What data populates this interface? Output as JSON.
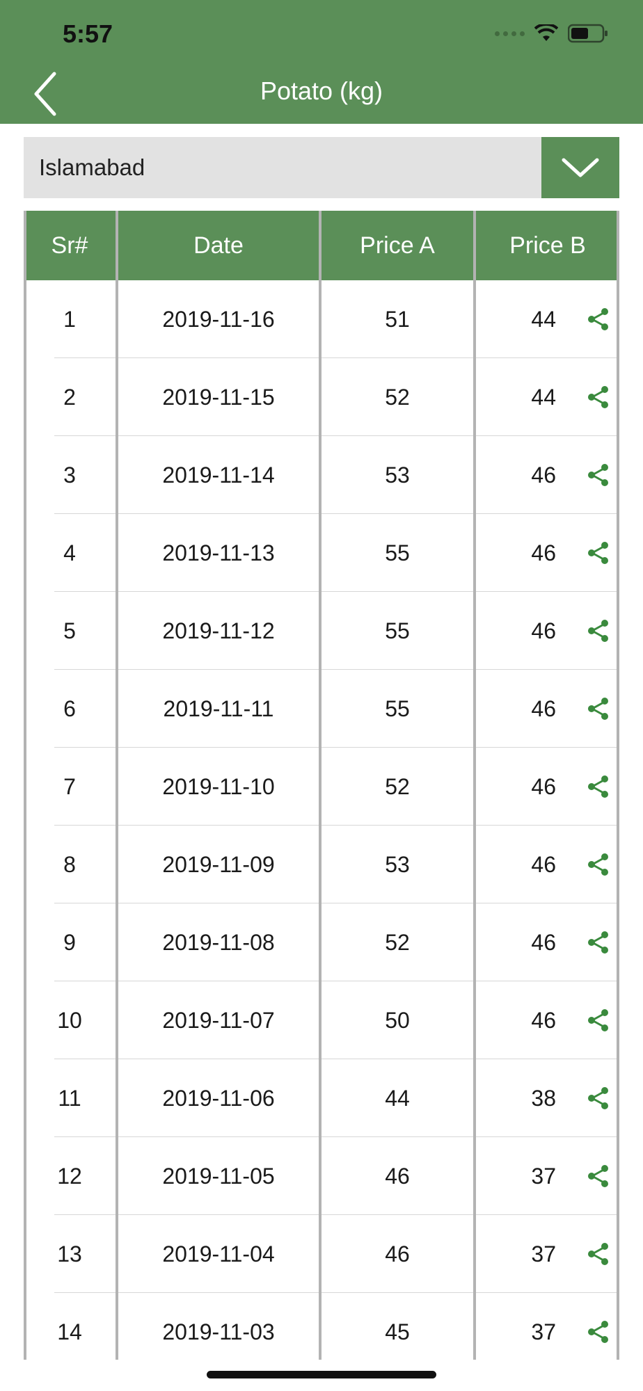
{
  "status_bar": {
    "time": "5:57"
  },
  "header": {
    "title": "Potato (kg)"
  },
  "city_select": {
    "selected": "Islamabad"
  },
  "table": {
    "headers": [
      "Sr#",
      "Date",
      "Price A",
      "Price B"
    ],
    "rows": [
      {
        "sr": "1",
        "date": "2019-11-16",
        "price_a": "51",
        "price_b": "44"
      },
      {
        "sr": "2",
        "date": "2019-11-15",
        "price_a": "52",
        "price_b": "44"
      },
      {
        "sr": "3",
        "date": "2019-11-14",
        "price_a": "53",
        "price_b": "46"
      },
      {
        "sr": "4",
        "date": "2019-11-13",
        "price_a": "55",
        "price_b": "46"
      },
      {
        "sr": "5",
        "date": "2019-11-12",
        "price_a": "55",
        "price_b": "46"
      },
      {
        "sr": "6",
        "date": "2019-11-11",
        "price_a": "55",
        "price_b": "46"
      },
      {
        "sr": "7",
        "date": "2019-11-10",
        "price_a": "52",
        "price_b": "46"
      },
      {
        "sr": "8",
        "date": "2019-11-09",
        "price_a": "53",
        "price_b": "46"
      },
      {
        "sr": "9",
        "date": "2019-11-08",
        "price_a": "52",
        "price_b": "46"
      },
      {
        "sr": "10",
        "date": "2019-11-07",
        "price_a": "50",
        "price_b": "46"
      },
      {
        "sr": "11",
        "date": "2019-11-06",
        "price_a": "44",
        "price_b": "38"
      },
      {
        "sr": "12",
        "date": "2019-11-05",
        "price_a": "46",
        "price_b": "37"
      },
      {
        "sr": "13",
        "date": "2019-11-04",
        "price_a": "46",
        "price_b": "37"
      },
      {
        "sr": "14",
        "date": "2019-11-03",
        "price_a": "45",
        "price_b": "37"
      }
    ]
  },
  "colors": {
    "brand_green": "#5b8f58",
    "icon_green": "#3a8a3d",
    "dropdown_bg": "#e2e2e2"
  },
  "icons": {
    "back": "chevron-left-icon",
    "dropdown": "chevron-down-icon",
    "row_action": "share-icon"
  }
}
